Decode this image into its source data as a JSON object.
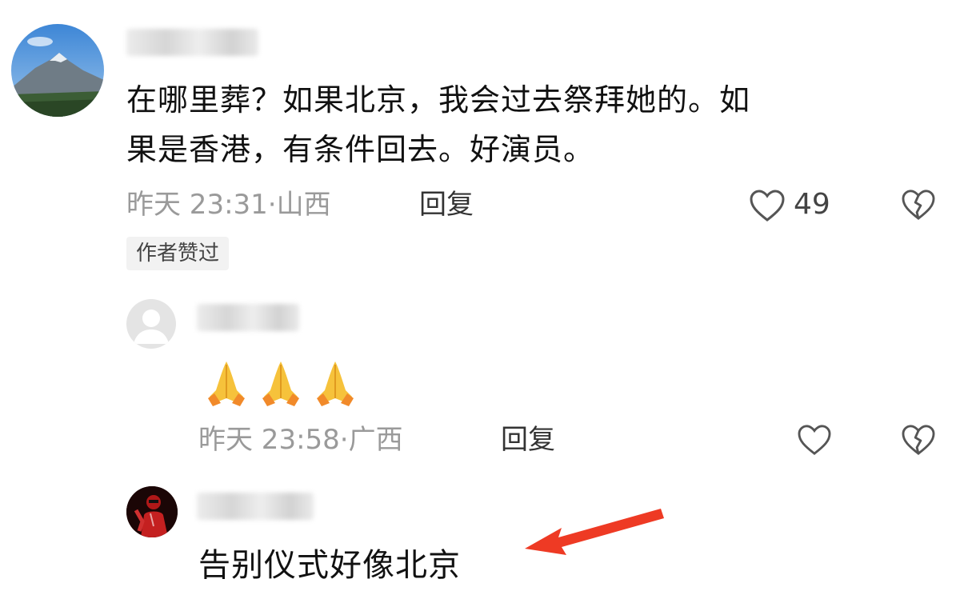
{
  "comments": [
    {
      "text_line1": "在哪里葬？如果北京，我会过去祭拜她的。如",
      "text_line2": "果是香港，有条件回去。好演员。",
      "time": "昨天 23:31",
      "location": "山西",
      "reply_label": "回复",
      "likes": "49",
      "badge": "作者赞过"
    },
    {
      "time": "昨天 23:58",
      "location": "广西",
      "reply_label": "回复",
      "emojis": "🙏🙏🙏"
    },
    {
      "text": "告别仪式好像北京"
    }
  ],
  "meta_separator": "·",
  "icons": [
    "heart-icon",
    "broken-heart-icon",
    "default-avatar-icon",
    "folded-hands-emoji",
    "arrow-icon"
  ],
  "colors": {
    "arrow": "#ee3a24",
    "meta": "#9a9a9a",
    "badge_bg": "#f2f2f2"
  }
}
